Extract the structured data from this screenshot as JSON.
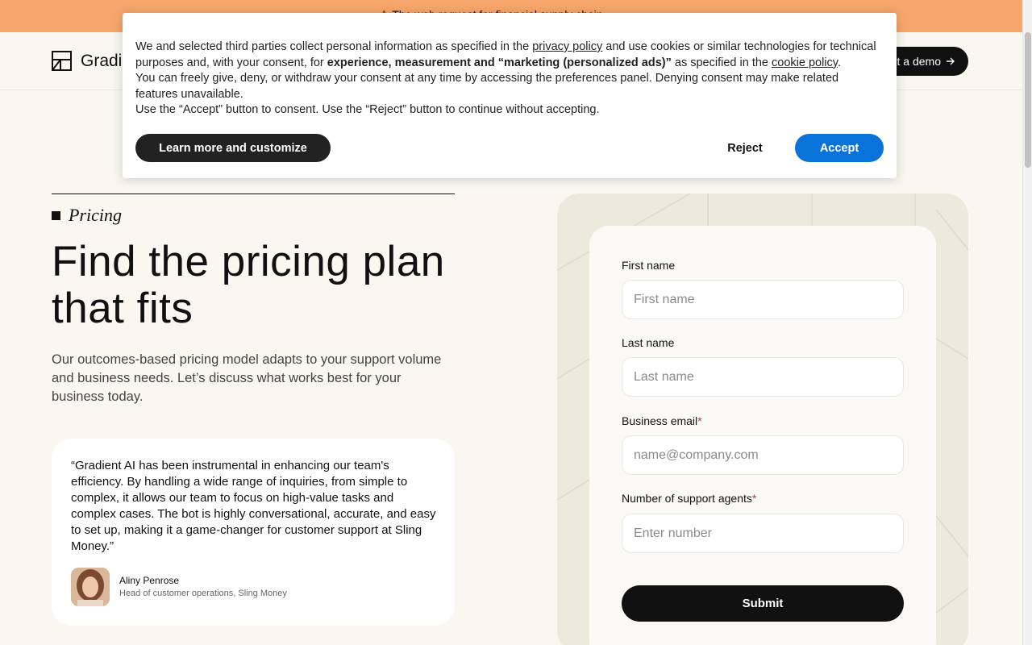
{
  "banner": {
    "text": "⚠ The web request for financial supply chain"
  },
  "nav": {
    "logo_text": "Gradient",
    "logo_icon": "gradient-logo-icon",
    "demo_button": "Get a demo",
    "demo_icon": "arrow-right-icon"
  },
  "hero": {
    "eyebrow": "Pricing",
    "title": "Find the pricing plan that fits",
    "description": "Our outcomes-based pricing model adapts to your support volume and business needs. Let’s discuss what works best for your business today."
  },
  "testimonial": {
    "quote": "“Gradient AI has been instrumental in enhancing our team's efficiency. By handling a wide range of inquiries, from simple to complex, it allows our team to focus on high-value tasks and complex cases. The bot is highly conversational, accurate, and easy to set up, making it a game-changer for customer support at Sling Money.”",
    "name": "Aliny Penrose",
    "role": "Head of customer operations, Sling Money"
  },
  "form": {
    "first_name": {
      "label": "First name",
      "placeholder": "First name",
      "value": ""
    },
    "last_name": {
      "label": "Last name",
      "placeholder": "Last name",
      "value": ""
    },
    "email": {
      "label": "Business email",
      "required_mark": "*",
      "placeholder": "name@company.com",
      "value": ""
    },
    "agents": {
      "label": "Number of support agents",
      "required_mark": "*",
      "placeholder": "Enter number",
      "value": ""
    },
    "submit": "Submit"
  },
  "cookie": {
    "p1_a": "We and selected third parties collect personal information as specified in the ",
    "privacy_link": "privacy policy",
    "p1_b": " and use cookies or similar technologies for technical purposes and, with your consent, for ",
    "p1_bold": "experience, measurement and “marketing (personalized ads)”",
    "p1_c": " as specified in the ",
    "cookie_link": "cookie policy",
    "p1_d": ".",
    "p2": "You can freely give, deny, or withdraw your consent at any time by accessing the preferences panel. Denying consent may make related features unavailable.",
    "p3": "Use the “Accept” button to consent. Use the “Reject” button to continue without accepting.",
    "learn_more": "Learn more and customize",
    "reject": "Reject",
    "accept": "Accept"
  },
  "colors": {
    "banner": "#f6a66b",
    "page_bg": "#faf7f1",
    "accept": "#0a73d9",
    "required": "#e0204a"
  }
}
